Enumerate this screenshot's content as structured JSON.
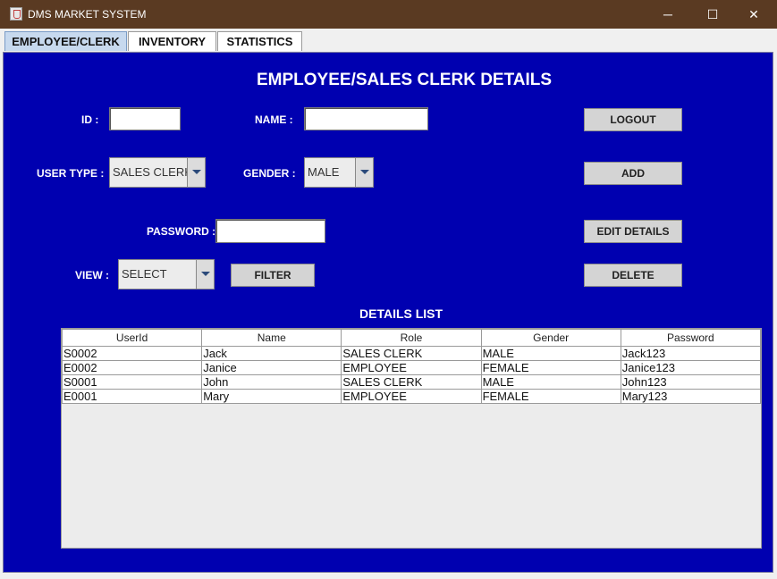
{
  "window": {
    "title": "DMS MARKET SYSTEM",
    "minimize": "─",
    "maximize": "☐",
    "close": "✕"
  },
  "tabs": [
    {
      "label": "EMPLOYEE/CLERK",
      "active": true
    },
    {
      "label": "INVENTORY",
      "active": false
    },
    {
      "label": "STATISTICS",
      "active": false
    }
  ],
  "form": {
    "heading": "EMPLOYEE/SALES CLERK DETAILS",
    "id_label": "ID :",
    "id_value": "",
    "name_label": "NAME :",
    "name_value": "",
    "user_type_label": "USER TYPE :",
    "user_type_value": "SALES CLERK",
    "gender_label": "GENDER :",
    "gender_value": "MALE",
    "password_label": "PASSWORD :",
    "password_value": "",
    "view_label": "VIEW :",
    "view_value": "SELECT"
  },
  "buttons": {
    "logout": "LOGOUT",
    "add": "ADD",
    "edit": "EDIT DETAILS",
    "delete": "DELETE",
    "filter": "FILTER"
  },
  "list": {
    "title": "DETAILS LIST",
    "columns": [
      "UserId",
      "Name",
      "Role",
      "Gender",
      "Password"
    ],
    "rows": [
      [
        "S0002",
        "Jack",
        "SALES CLERK",
        "MALE",
        "Jack123"
      ],
      [
        "E0002",
        "Janice",
        "EMPLOYEE",
        "FEMALE",
        "Janice123"
      ],
      [
        "S0001",
        "John",
        "SALES CLERK",
        "MALE",
        "John123"
      ],
      [
        "E0001",
        "Mary",
        "EMPLOYEE",
        "FEMALE",
        "Mary123"
      ]
    ]
  },
  "colors": {
    "panel_bg": "#0000b0",
    "titlebar_bg": "#5a3a22",
    "active_tab": "#c7d9ee"
  }
}
